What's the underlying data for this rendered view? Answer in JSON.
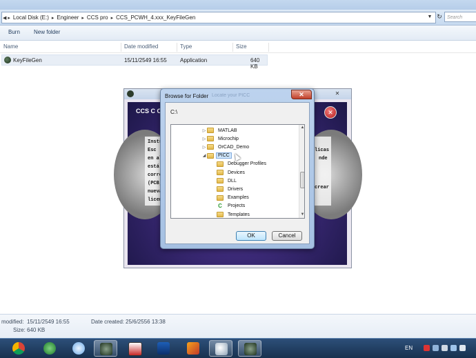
{
  "explorer": {
    "breadcrumb": [
      "Local Disk (E:)",
      "Engineer",
      "CCS pro",
      "CCS_PCWH_4.xxx_KeyFileGen"
    ],
    "search_placeholder": "Search CCS...",
    "toolbar": {
      "burn": "Burn",
      "new_folder": "New folder"
    },
    "columns": {
      "name": "Name",
      "date_modified": "Date modified",
      "type": "Type",
      "size": "Size"
    },
    "files": [
      {
        "name": "KeyFileGen",
        "date_modified": "15/11/2549 16:55",
        "type": "Application",
        "size": "640 KB"
      }
    ],
    "details": {
      "modified_label": "modified:",
      "modified_value": "15/11/2549 16:55",
      "created_label": "Date created:",
      "created_value": "25/6/2556 13:38",
      "size_label": "Size:",
      "size_value": "640 KB"
    }
  },
  "keygen": {
    "caption": "CCS C Co",
    "text_left": [
      "Instr",
      "Esc",
      "en al",
      "está",
      "corre",
      "(PCB,",
      "nueva",
      "licen"
    ],
    "text_right": [
      "licas",
      "nde",
      "",
      "",
      "",
      "crear"
    ]
  },
  "dialog": {
    "title": "Browse for Folder",
    "ghost_title": "Locate your PICC",
    "selected_path": "C:\\",
    "tree": [
      {
        "label": "MATLAB",
        "indent": 1,
        "arrow": "▷",
        "icon": "folder-icon"
      },
      {
        "label": "Microchip",
        "indent": 1,
        "arrow": "▷",
        "icon": "folder-icon"
      },
      {
        "label": "OrCAD_Demo",
        "indent": 1,
        "arrow": "▷",
        "icon": "folder-icon"
      },
      {
        "label": "PICC",
        "indent": 1,
        "arrow": "◢",
        "icon": "folder-icon",
        "selected": true
      },
      {
        "label": "Debugger Profiles",
        "indent": 2,
        "arrow": "",
        "icon": "folder-icon"
      },
      {
        "label": "Devices",
        "indent": 2,
        "arrow": "",
        "icon": "folder-icon"
      },
      {
        "label": "DLL",
        "indent": 2,
        "arrow": "",
        "icon": "folder-icon"
      },
      {
        "label": "Drivers",
        "indent": 2,
        "arrow": "",
        "icon": "folder-icon"
      },
      {
        "label": "Examples",
        "indent": 2,
        "arrow": "",
        "icon": "folder-icon"
      },
      {
        "label": "Projects",
        "indent": 2,
        "arrow": "",
        "icon": "ccs-project-icon"
      },
      {
        "label": "Templates",
        "indent": 2,
        "arrow": "",
        "icon": "folder-icon"
      }
    ],
    "ok_label": "OK",
    "cancel_label": "Cancel"
  },
  "taskbar": {
    "apps": [
      "chrome",
      "thunderbolt",
      "network",
      "keygen",
      "pickit2",
      "isis",
      "matlab",
      "search",
      "ccs"
    ],
    "language": "EN"
  },
  "colors": {
    "accent": "#3c7fb1",
    "selection": "#cfe6fc",
    "taskbar": "#1d3a5e"
  }
}
